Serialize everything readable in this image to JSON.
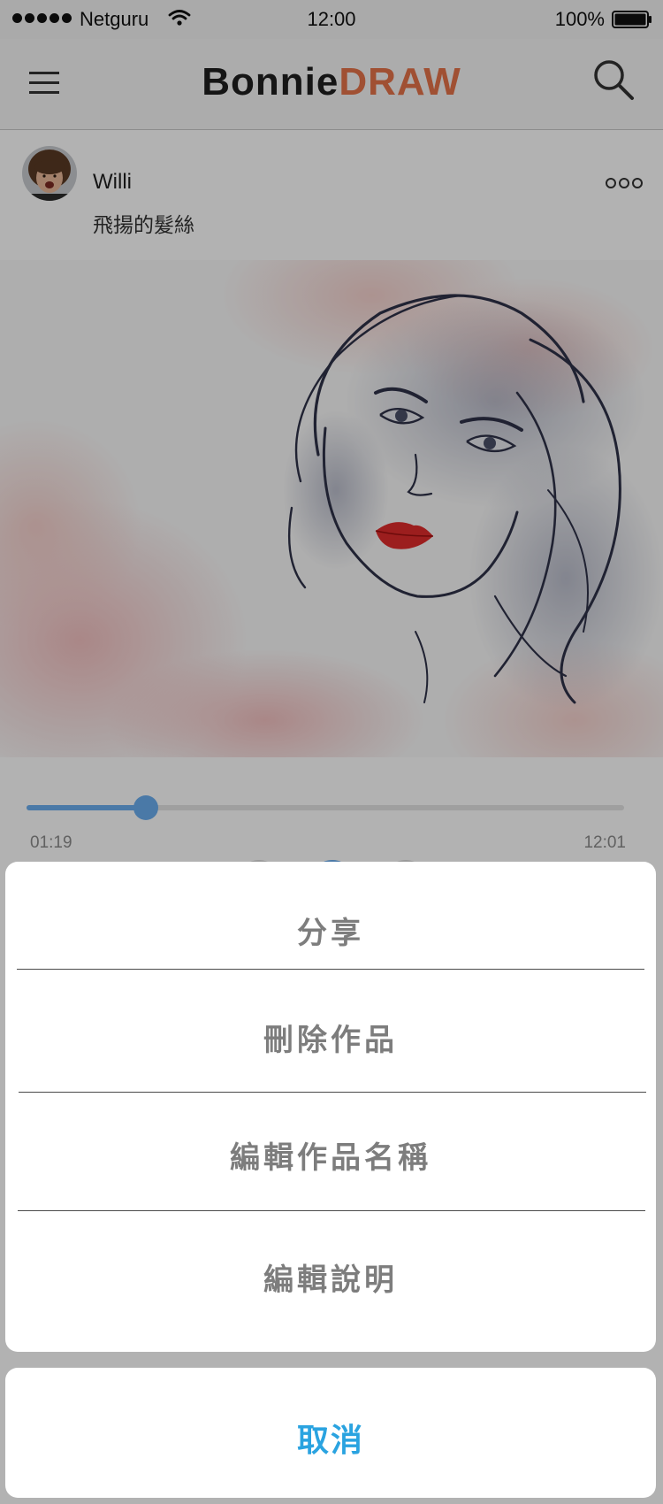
{
  "status_bar": {
    "carrier": "Netguru",
    "time": "12:00",
    "battery": "100%"
  },
  "nav": {
    "logo_part1": "Bonnie",
    "logo_part2": "DRAW",
    "menu_icon": "hamburger-icon",
    "search_icon": "search-icon"
  },
  "post": {
    "author": "Willi",
    "title": "飛揚的髮絲",
    "more_icon": "more-dots-icon"
  },
  "player": {
    "current_time": "01:19",
    "total_time": "12:01",
    "progress": 0.2
  },
  "action_sheet": {
    "items": [
      {
        "label": "分享"
      },
      {
        "label": "刪除作品"
      },
      {
        "label": "編輯作品名稱"
      },
      {
        "label": "編輯說明"
      }
    ],
    "cancel_label": "取消"
  },
  "colors": {
    "accent_blue": "#2aa3e0",
    "progress_blue": "#6aaef0",
    "logo_orange": "#e6734a"
  }
}
